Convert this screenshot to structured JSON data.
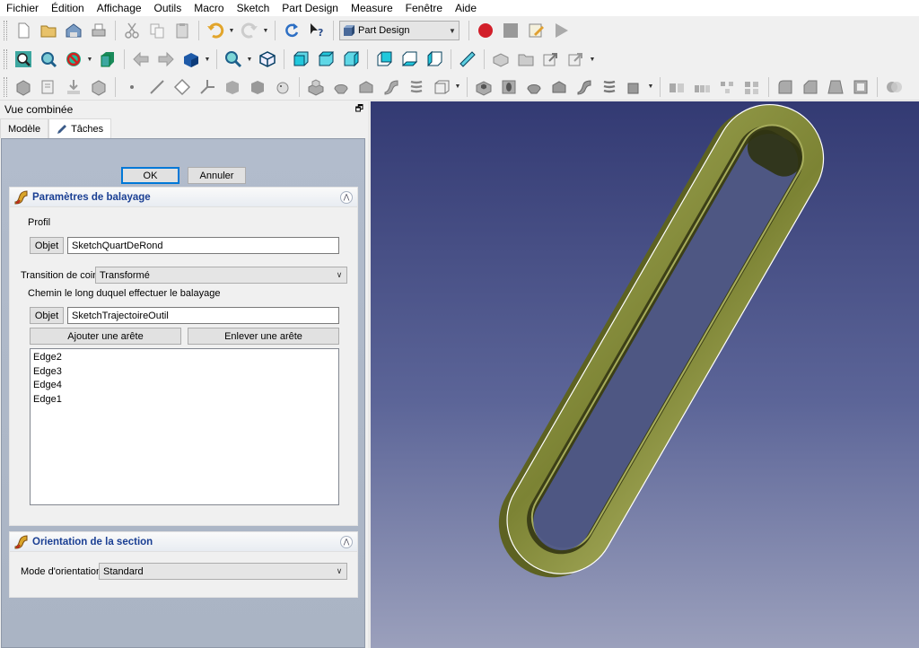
{
  "menu": [
    "Fichier",
    "Édition",
    "Affichage",
    "Outils",
    "Macro",
    "Sketch",
    "Part Design",
    "Measure",
    "Fenêtre",
    "Aide"
  ],
  "toolbar": {
    "workbench": "Part Design"
  },
  "panel": {
    "title": "Vue combinée",
    "tabs": [
      "Modèle",
      "Tâches"
    ],
    "ok_label": "OK",
    "cancel_label": "Annuler",
    "sweep": {
      "title": "Paramètres de balayage",
      "profile_label": "Profil",
      "object_button": "Objet",
      "profile_value": "SketchQuartDeRond",
      "transition_label": "Transition de coin",
      "transition_value": "Transformé",
      "path_label": "Chemin le long duquel effectuer le balayage",
      "path_object_button": "Objet",
      "path_value": "SketchTrajectoireOutil",
      "add_edge": "Ajouter une arête",
      "remove_edge": "Enlever une arête",
      "edges": [
        "Edge2",
        "Edge3",
        "Edge4",
        "Edge1"
      ]
    },
    "orientation": {
      "title": "Orientation de la section",
      "mode_label": "Mode d'orientation",
      "mode_value": "Standard"
    }
  },
  "colors": {
    "part_face": "#808838",
    "part_inner": "#3e4118",
    "edge_highlight": "#ffffff"
  }
}
